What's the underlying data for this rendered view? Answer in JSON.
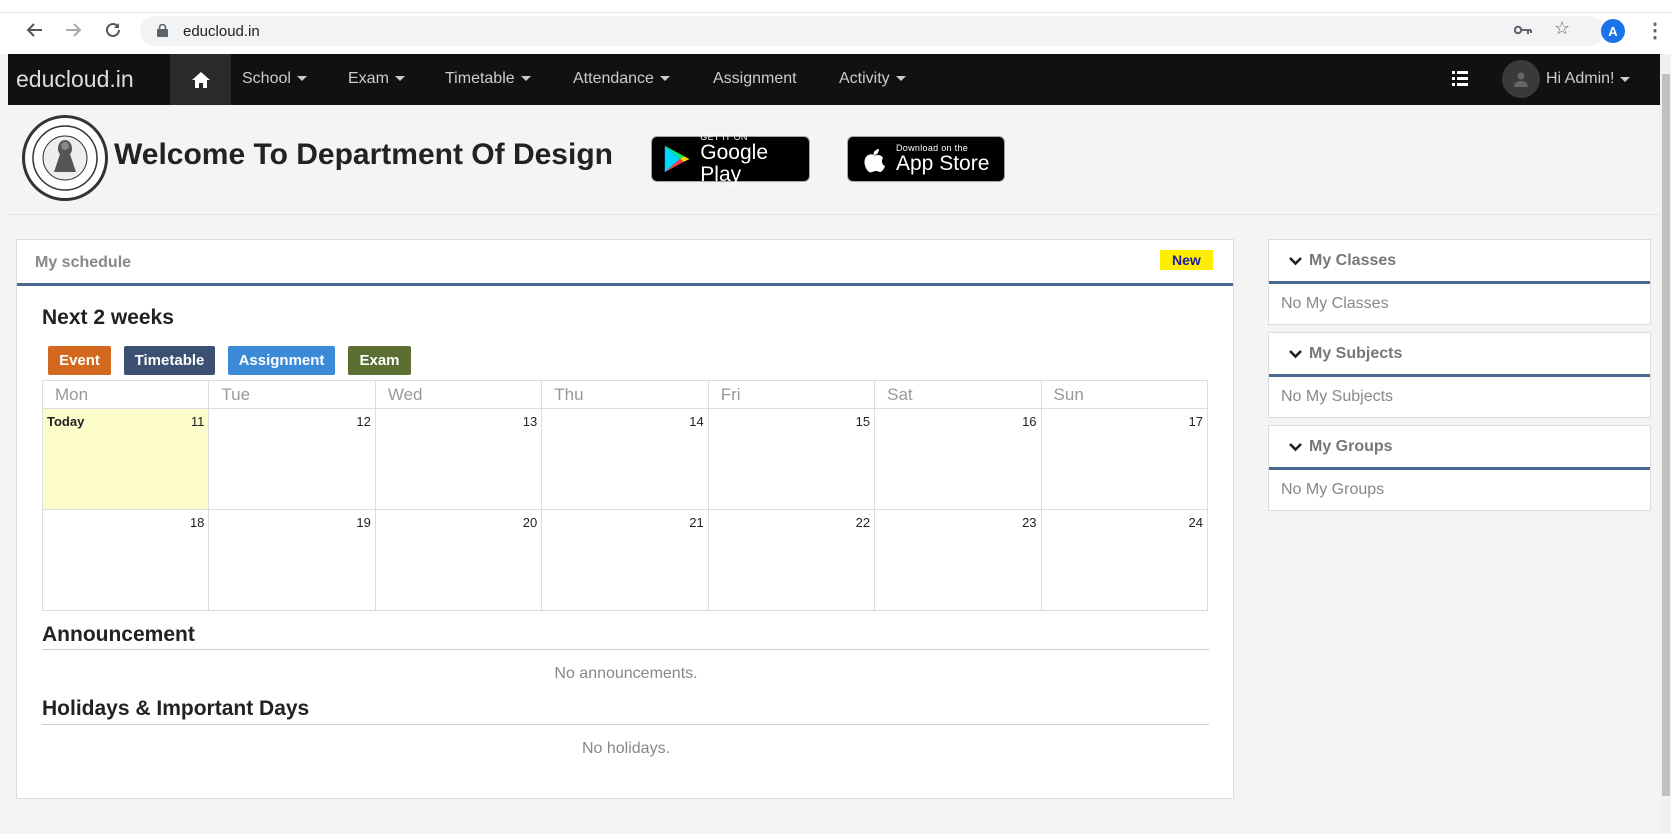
{
  "browser": {
    "url": "educloud.in",
    "profile_initial": "A"
  },
  "navbar": {
    "brand": "educloud.in",
    "items": [
      {
        "label": "School",
        "has_caret": true
      },
      {
        "label": "Exam",
        "has_caret": true
      },
      {
        "label": "Timetable",
        "has_caret": true
      },
      {
        "label": "Attendance",
        "has_caret": true
      },
      {
        "label": "Assignment",
        "has_caret": false
      },
      {
        "label": "Activity",
        "has_caret": true
      }
    ],
    "user_greeting": "Hi Admin!"
  },
  "header": {
    "welcome": "Welcome To Department Of Design",
    "google_play": {
      "small": "GET IT ON",
      "big": "Google Play"
    },
    "app_store": {
      "small": "Download on the",
      "big": "App Store"
    }
  },
  "schedule": {
    "title": "My schedule",
    "badge": "New",
    "heading": "Next 2 weeks",
    "legend": [
      {
        "label": "Event",
        "color": "#d2691e"
      },
      {
        "label": "Timetable",
        "color": "#3b5072"
      },
      {
        "label": "Assignment",
        "color": "#3b8ad8"
      },
      {
        "label": "Exam",
        "color": "#5b6f32"
      }
    ],
    "days": [
      "Mon",
      "Tue",
      "Wed",
      "Thu",
      "Fri",
      "Sat",
      "Sun"
    ],
    "today_label": "Today",
    "weeks": [
      [
        "11",
        "12",
        "13",
        "14",
        "15",
        "16",
        "17"
      ],
      [
        "18",
        "19",
        "20",
        "21",
        "22",
        "23",
        "24"
      ]
    ]
  },
  "announcement": {
    "heading": "Announcement",
    "empty": "No announcements."
  },
  "holidays": {
    "heading": "Holidays & Important Days",
    "empty": "No holidays."
  },
  "sidebar": {
    "classes": {
      "title": "My Classes",
      "empty": "No My Classes"
    },
    "subjects": {
      "title": "My Subjects",
      "empty": "No My Subjects"
    },
    "groups": {
      "title": "My Groups",
      "empty": "No My Groups"
    }
  },
  "colors": {
    "navbar_bg": "#111111",
    "accent_border": "#4a6990",
    "today_bg": "#fdfccb",
    "badge_bg": "#ffee00"
  }
}
